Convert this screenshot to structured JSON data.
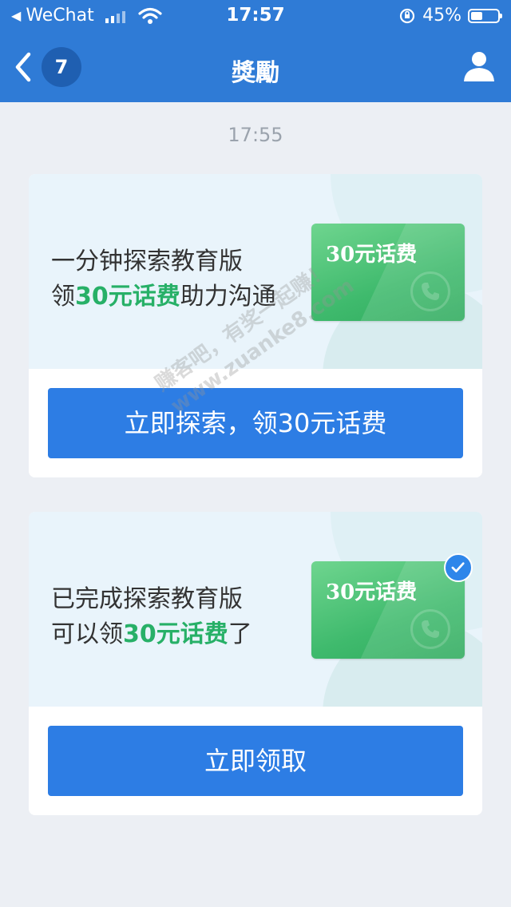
{
  "status_bar": {
    "carrier": "WeChat",
    "time": "17:57",
    "battery": "45%",
    "battery_level": 0.45
  },
  "nav": {
    "unread_count": "7",
    "title": "獎勵"
  },
  "chat": {
    "timestamp": "17:55"
  },
  "cards": [
    {
      "line1": "一分钟探索教育版",
      "line2_prefix": "领",
      "line2_highlight": "30元话费",
      "line2_suffix": "助力沟通",
      "ticket_label": "30元话费",
      "button_label": "立即探索，领30元话费",
      "checked": false
    },
    {
      "line1": "已完成探索教育版",
      "line2_prefix": "可以领",
      "line2_highlight": "30元话费",
      "line2_suffix": "了",
      "ticket_label": "30元话费",
      "button_label": "立即领取",
      "checked": true
    }
  ],
  "watermark": {
    "line1": "赚客吧，有奖一起赚！",
    "line2": "www.zuanke8.com"
  },
  "colors": {
    "nav_bg": "#2f7bd6",
    "button_bg": "#2d7de4",
    "highlight_green": "#27b067",
    "page_bg": "#eceff4"
  }
}
